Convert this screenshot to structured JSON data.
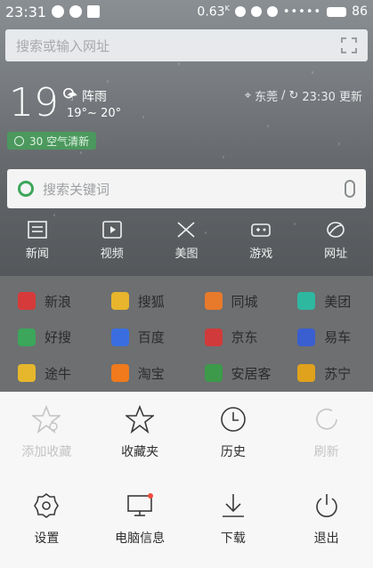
{
  "status": {
    "time": "23:31",
    "speed": "0.63",
    "battery": "86"
  },
  "top_search": {
    "placeholder": "搜索或输入网址"
  },
  "weather": {
    "temp": "19°",
    "condition": "阵雨",
    "range": "19°~ 20°",
    "location": "东莞",
    "updated": "23:30 更新",
    "air": "30 空气清新"
  },
  "keyword_search": {
    "placeholder": "搜索关键词"
  },
  "categories": [
    {
      "label": "新闻",
      "icon": "news-icon"
    },
    {
      "label": "视频",
      "icon": "video-icon"
    },
    {
      "label": "美图",
      "icon": "photo-icon"
    },
    {
      "label": "游戏",
      "icon": "game-icon"
    },
    {
      "label": "网址",
      "icon": "sites-icon"
    }
  ],
  "sites": [
    {
      "label": "新浪",
      "color": "#d63a3a"
    },
    {
      "label": "搜狐",
      "color": "#e8b52c"
    },
    {
      "label": "同城",
      "color": "#e87a2c"
    },
    {
      "label": "美团",
      "color": "#2eb8a0"
    },
    {
      "label": "好搜",
      "color": "#3ca65a"
    },
    {
      "label": "百度",
      "color": "#3a6ee0"
    },
    {
      "label": "京东",
      "color": "#d03a3a"
    },
    {
      "label": "易车",
      "color": "#3a5fd0"
    },
    {
      "label": "途牛",
      "color": "#e6b72c"
    },
    {
      "label": "淘宝",
      "color": "#f07a1c"
    },
    {
      "label": "安居客",
      "color": "#3c9a4a"
    },
    {
      "label": "苏宁",
      "color": "#e0a21c"
    }
  ],
  "menu": {
    "add_favorite": "添加收藏",
    "favorites": "收藏夹",
    "history": "历史",
    "refresh": "刷新",
    "settings": "设置",
    "pc_info": "电脑信息",
    "download": "下载",
    "exit": "退出"
  }
}
